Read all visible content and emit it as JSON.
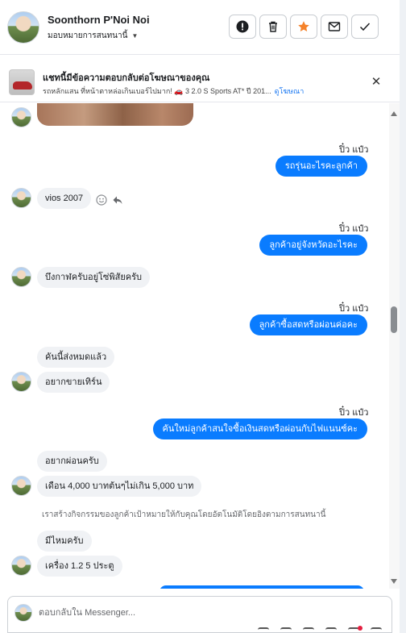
{
  "header": {
    "contact_name": "Soonthorn P'Noi Noi",
    "assign_label": "มอบหมายการสนทนานี้",
    "buttons": [
      "mark-spam",
      "delete",
      "star",
      "mark-unread",
      "mark-done"
    ]
  },
  "ad_banner": {
    "title": "แชทนี้มีข้อความตอบกลับต่อโฆษณาของคุณ",
    "subtitle": "รถหลักแสน ที่หน้าตาหล่อเกินเบอร์ไปมาก! 🚗 3 2.0 S Sports AT* ปี 201...",
    "link_label": "ดูโฆษณา"
  },
  "messages": {
    "m1_sender": "ปิ๋ว แป๋ว",
    "m1_text": "รถรุ่นอะไรคะลูกค้า",
    "m2_text": "vios 2007",
    "m3_sender": "ปิ๋ว แป๋ว",
    "m3_text": "ลูกค้าอยู่จังหวัดอะไรคะ",
    "m4_text": "บึงกาฬครับอยู่โซ่พิสัยครับ",
    "m5_sender": "ปิ๋ว แป๋ว",
    "m5_text": "ลูกค้าซื้อสดหรือผ่อนค่อคะ",
    "m6_text": "คันนี้ส่งหมดแล้ว",
    "m7_text": "อยากขายเทิร์น",
    "m8_sender": "ปิ๋ว แป๋ว",
    "m8_text": "คันใหม่ลูกค้าสนใจซื้อเงินสดหรือผ่อนกับไฟแนนซ์คะ",
    "m9_text": "อยากผ่อนครับ",
    "m10_text": "เดือน 4,000 บาทต้นๆไม่เกิน 5,000 บาท",
    "system_note": "เราสร้างกิจกรรมของลูกค้าเป้าหมายให้กับคุณโดยอัตโนมัติโดยอิงตามการสนทนานี้",
    "m11_text": "มีไหมครับ",
    "m12_text": "เครื่อง 1.2  5 ประตู"
  },
  "composer": {
    "placeholder": "ตอบกลับใน Messenger..."
  },
  "colors": {
    "outgoing_bubble": "#0a7cff",
    "incoming_bubble": "#f0f2f5",
    "star_accent": "#f5822a"
  }
}
